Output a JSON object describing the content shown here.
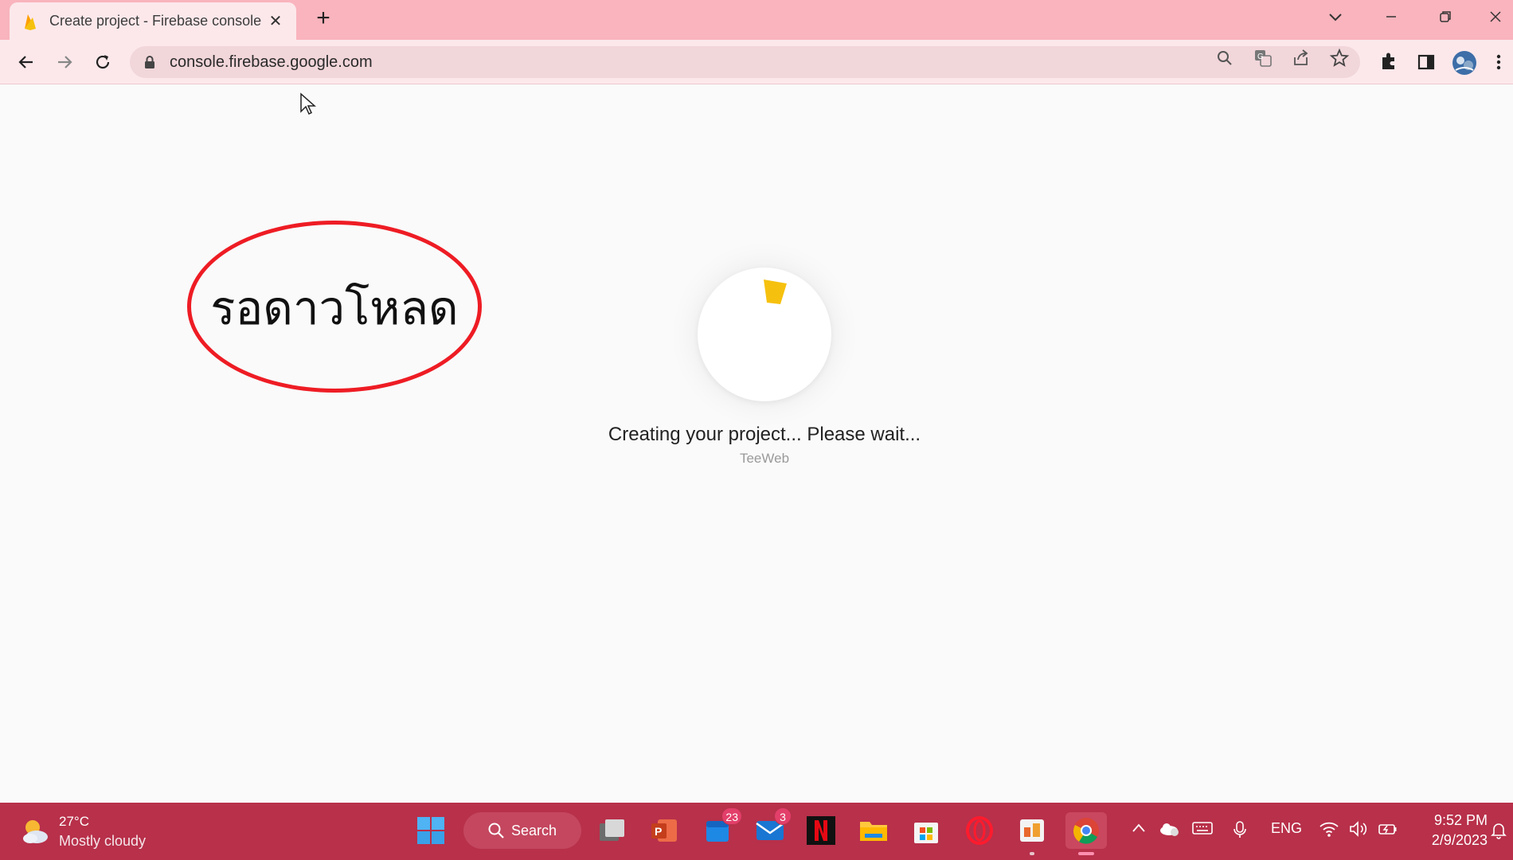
{
  "browser": {
    "tab_title": "Create project - Firebase console",
    "new_tab_symbol": "+",
    "url": "console.firebase.google.com"
  },
  "page": {
    "annotation_text": "รอดาวโหลด",
    "status_text": "Creating your project... Please wait...",
    "watermark": "TeeWeb"
  },
  "taskbar": {
    "weather_temp": "27°C",
    "weather_condition": "Mostly cloudy",
    "search_label": "Search",
    "teams_badge": "23",
    "mail_badge": "3",
    "language": "ENG",
    "time": "9:52 PM",
    "date": "2/9/2023"
  },
  "colors": {
    "tabstrip": "#f9b4bd",
    "toolbar": "#fce8eb",
    "taskbar": "#b8304a",
    "annotation": "#ee1c24",
    "firebase_yellow": "#f6c10e"
  },
  "icons": [
    "firebase-icon",
    "close-icon",
    "plus-icon",
    "chevron-down-icon",
    "minimize-icon",
    "restore-icon",
    "back-icon",
    "forward-icon",
    "reload-icon",
    "lock-icon",
    "zoom-icon",
    "translate-icon",
    "share-icon",
    "star-icon",
    "extensions-icon",
    "sidepanel-icon",
    "profile-avatar",
    "menu-icon"
  ]
}
